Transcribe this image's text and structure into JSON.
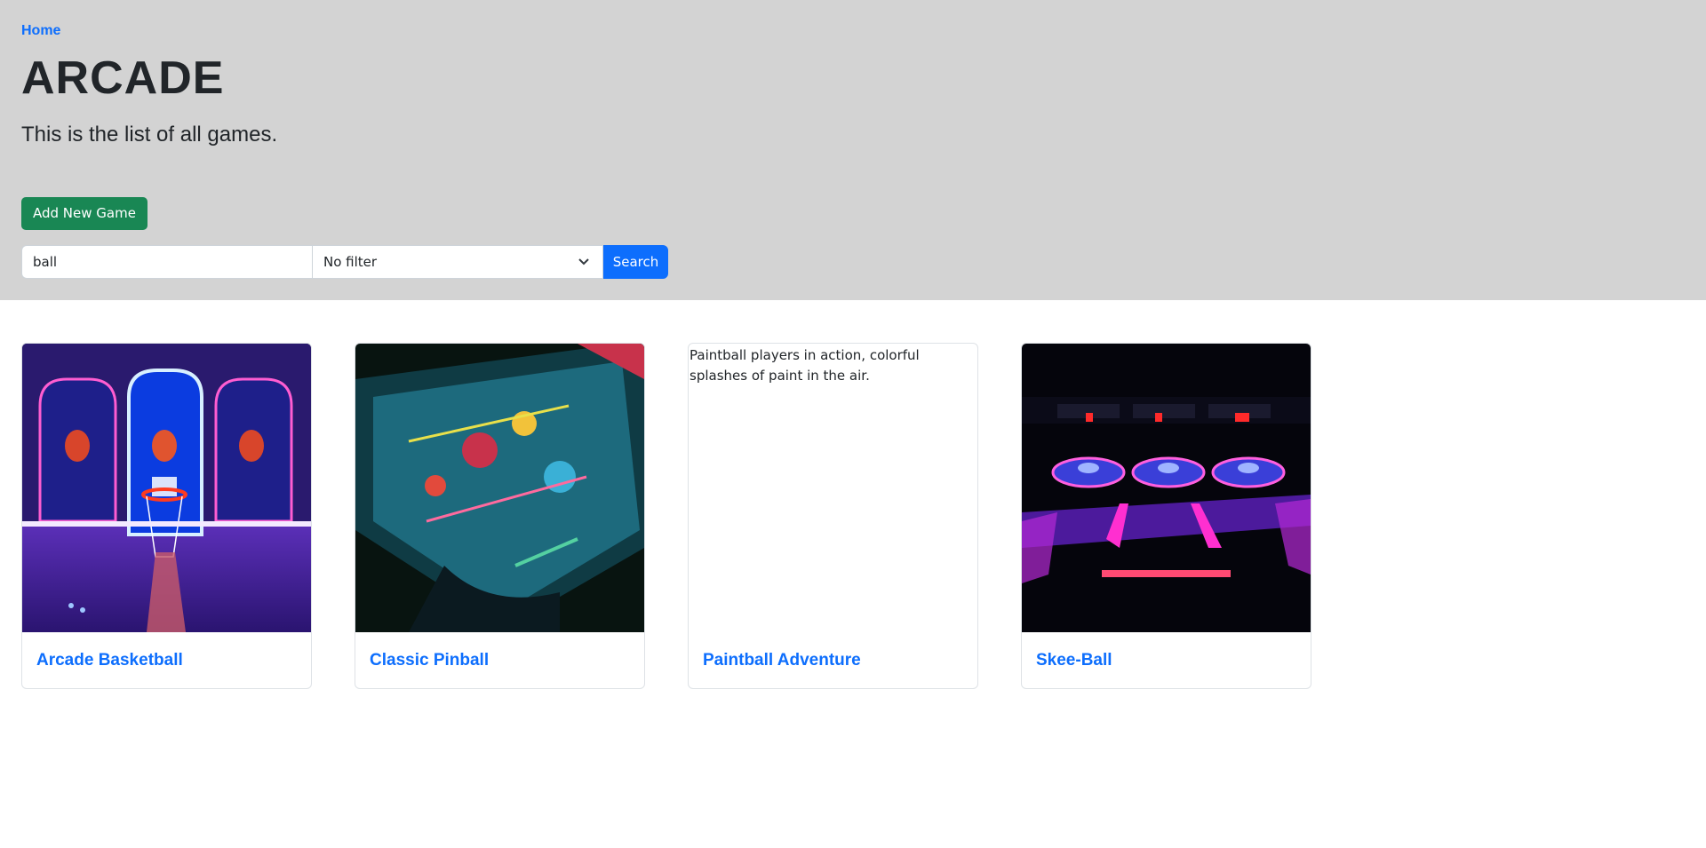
{
  "breadcrumb": {
    "home": "Home"
  },
  "header": {
    "title": "ARCADE",
    "subtitle": "This is the list of all games."
  },
  "actions": {
    "add_label": "Add New Game"
  },
  "search": {
    "value": "ball",
    "filter_selected": "No filter",
    "button_label": "Search"
  },
  "games": [
    {
      "title": "Arcade Basketball",
      "image_kind": "arcade-basketball-photo"
    },
    {
      "title": "Classic Pinball",
      "image_kind": "pinball-machine-photo"
    },
    {
      "title": "Paintball Adventure",
      "image_alt": "Paintball players in action, colorful splashes of paint in the air.",
      "image_kind": "broken-image"
    },
    {
      "title": "Skee-Ball",
      "image_kind": "skee-ball-lanes-photo"
    }
  ],
  "colors": {
    "hero_bg": "#d3d3d3",
    "link": "#0d6efd",
    "add_button": "#198754",
    "search_button": "#0d6efd"
  }
}
